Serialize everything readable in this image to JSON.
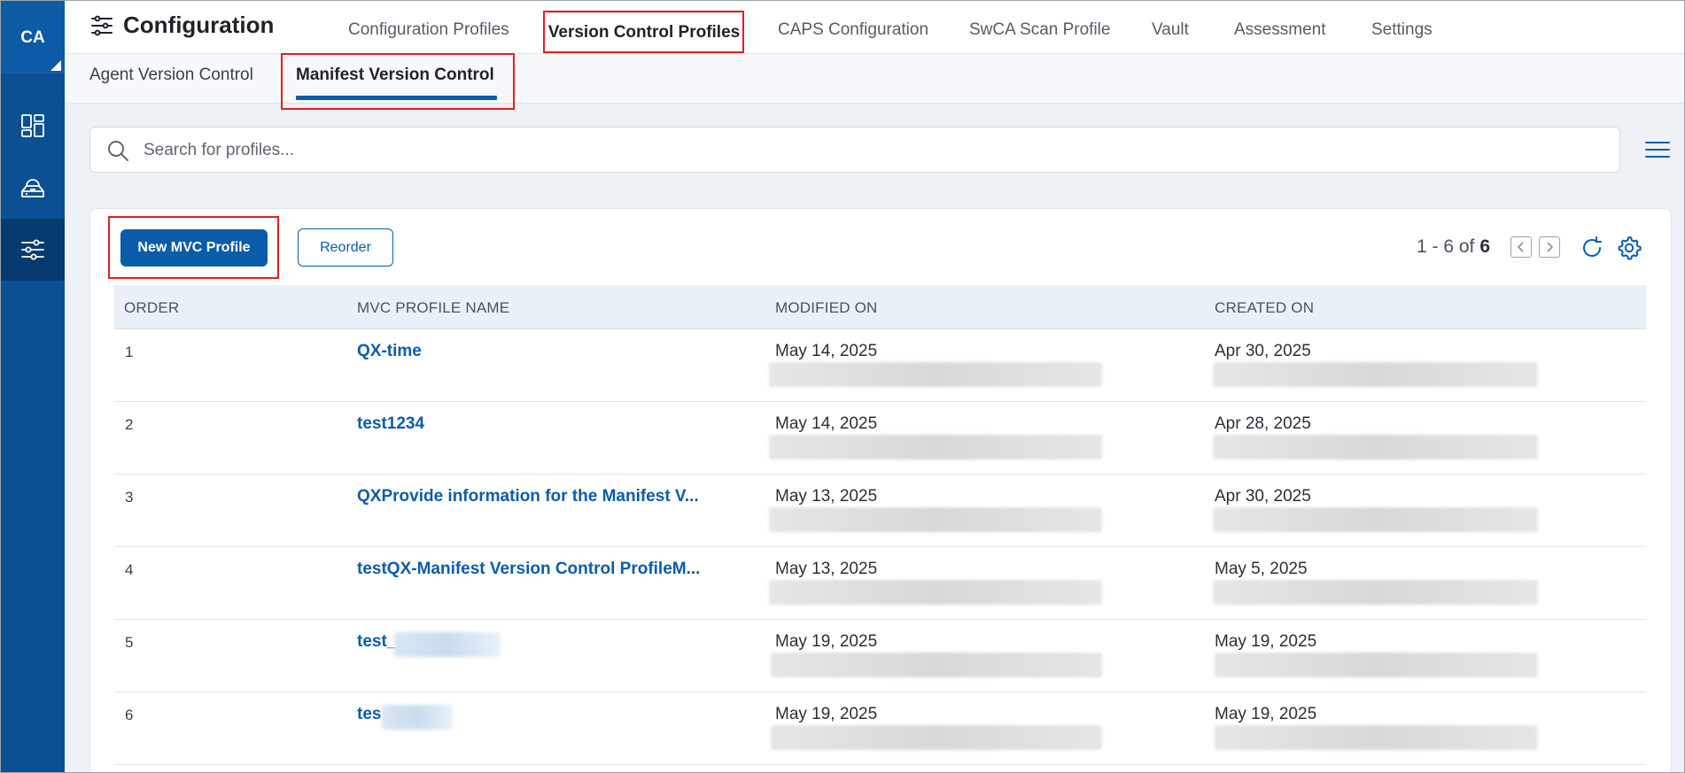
{
  "sidebar": {
    "logo": "CA",
    "items": [
      {
        "icon": "dashboard-icon"
      },
      {
        "icon": "cloud-stack-icon"
      },
      {
        "icon": "sliders-icon"
      }
    ]
  },
  "header": {
    "title": "Configuration",
    "tabs": [
      {
        "label": "Configuration Profiles"
      },
      {
        "label": "Version Control Profiles"
      },
      {
        "label": "CAPS Configuration"
      },
      {
        "label": "SwCA Scan Profile"
      },
      {
        "label": "Vault"
      },
      {
        "label": "Assessment"
      },
      {
        "label": "Settings"
      }
    ]
  },
  "subtabs": [
    {
      "label": "Agent Version Control"
    },
    {
      "label": "Manifest Version Control"
    }
  ],
  "search": {
    "placeholder": "Search for profiles..."
  },
  "toolbar": {
    "new_label": "New MVC Profile",
    "reorder_label": "Reorder",
    "pager_range": "1 - 6 of",
    "pager_total": "6"
  },
  "table": {
    "columns": [
      "ORDER",
      "MVC PROFILE NAME",
      "MODIFIED ON",
      "CREATED ON"
    ],
    "rows": [
      {
        "order": "1",
        "name": "QX-time",
        "modified": "May 14, 2025",
        "created": "Apr 30, 2025"
      },
      {
        "order": "2",
        "name": "test1234",
        "modified": "May 14, 2025",
        "created": "Apr 28, 2025"
      },
      {
        "order": "3",
        "name": "QXProvide information for the Manifest V...",
        "modified": "May 13, 2025",
        "created": "Apr 30, 2025"
      },
      {
        "order": "4",
        "name": "testQX-Manifest Version Control ProfileM...",
        "modified": "May 13, 2025",
        "created": "May 5, 2025"
      },
      {
        "order": "5",
        "name": "test_",
        "modified": "May 19, 2025",
        "created": "May 19, 2025"
      },
      {
        "order": "6",
        "name": "tes",
        "modified": "May 19, 2025",
        "created": "May 19, 2025"
      }
    ]
  },
  "colors": {
    "sidebar": "#0b4f94",
    "accent": "#0b5cab",
    "highlight": "#e02020"
  }
}
